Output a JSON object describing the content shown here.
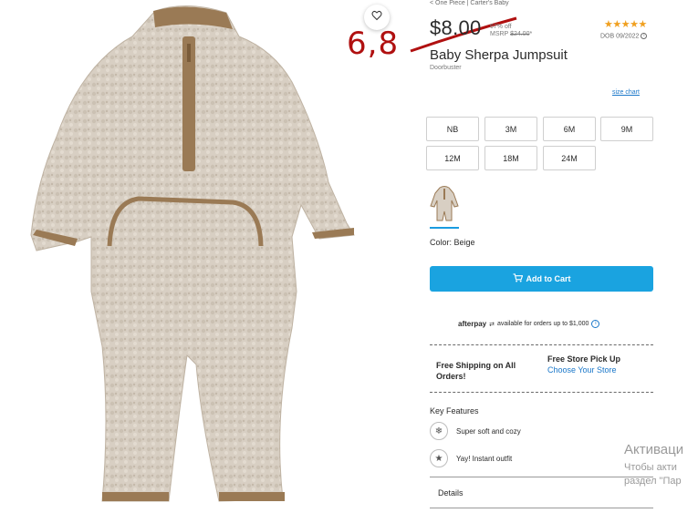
{
  "breadcrumb": "< One Piece  |  Carter's  Baby",
  "price": "$8.00",
  "discount_pct": "67% off",
  "msrp_label": "MSRP",
  "msrp_value": "$24.00",
  "msrp_suffix": "*",
  "rating_stars": "★★★★★",
  "rating_value": 5,
  "dob": "DOB 09/2022",
  "title": "Baby Sherpa Jumpsuit",
  "subtitle": "Doorbuster",
  "size_chart": "size chart",
  "sizes": [
    "NB",
    "3M",
    "6M",
    "9M",
    "12M",
    "18M",
    "24M"
  ],
  "color_label": "Color: Beige",
  "add_to_cart": "Add to Cart",
  "afterpay": {
    "logo": "afterpay",
    "text": "available for orders up to $1,000",
    "info": "i"
  },
  "shipping": "Free Shipping on All Orders!",
  "pickup_title": "Free Store Pick Up",
  "pickup_link": "Choose Your Store",
  "key_features_title": "Key Features",
  "features": [
    {
      "text": "Super soft and cozy",
      "icon": "snowflake-icon"
    },
    {
      "text": "Yay! Instant outfit",
      "icon": "star-badge-icon"
    }
  ],
  "details_label": "Details",
  "annotation": "6,8",
  "watermark": {
    "line1": "Активаци",
    "line2": "Чтобы акти",
    "line3": "раздел \"Пар"
  },
  "colors": {
    "accent": "#1aa3e0",
    "link": "#1a77c9",
    "star": "#f0a020",
    "annotation": "#b01010",
    "product": "#d8cfc3",
    "trim": "#9a7a55"
  }
}
